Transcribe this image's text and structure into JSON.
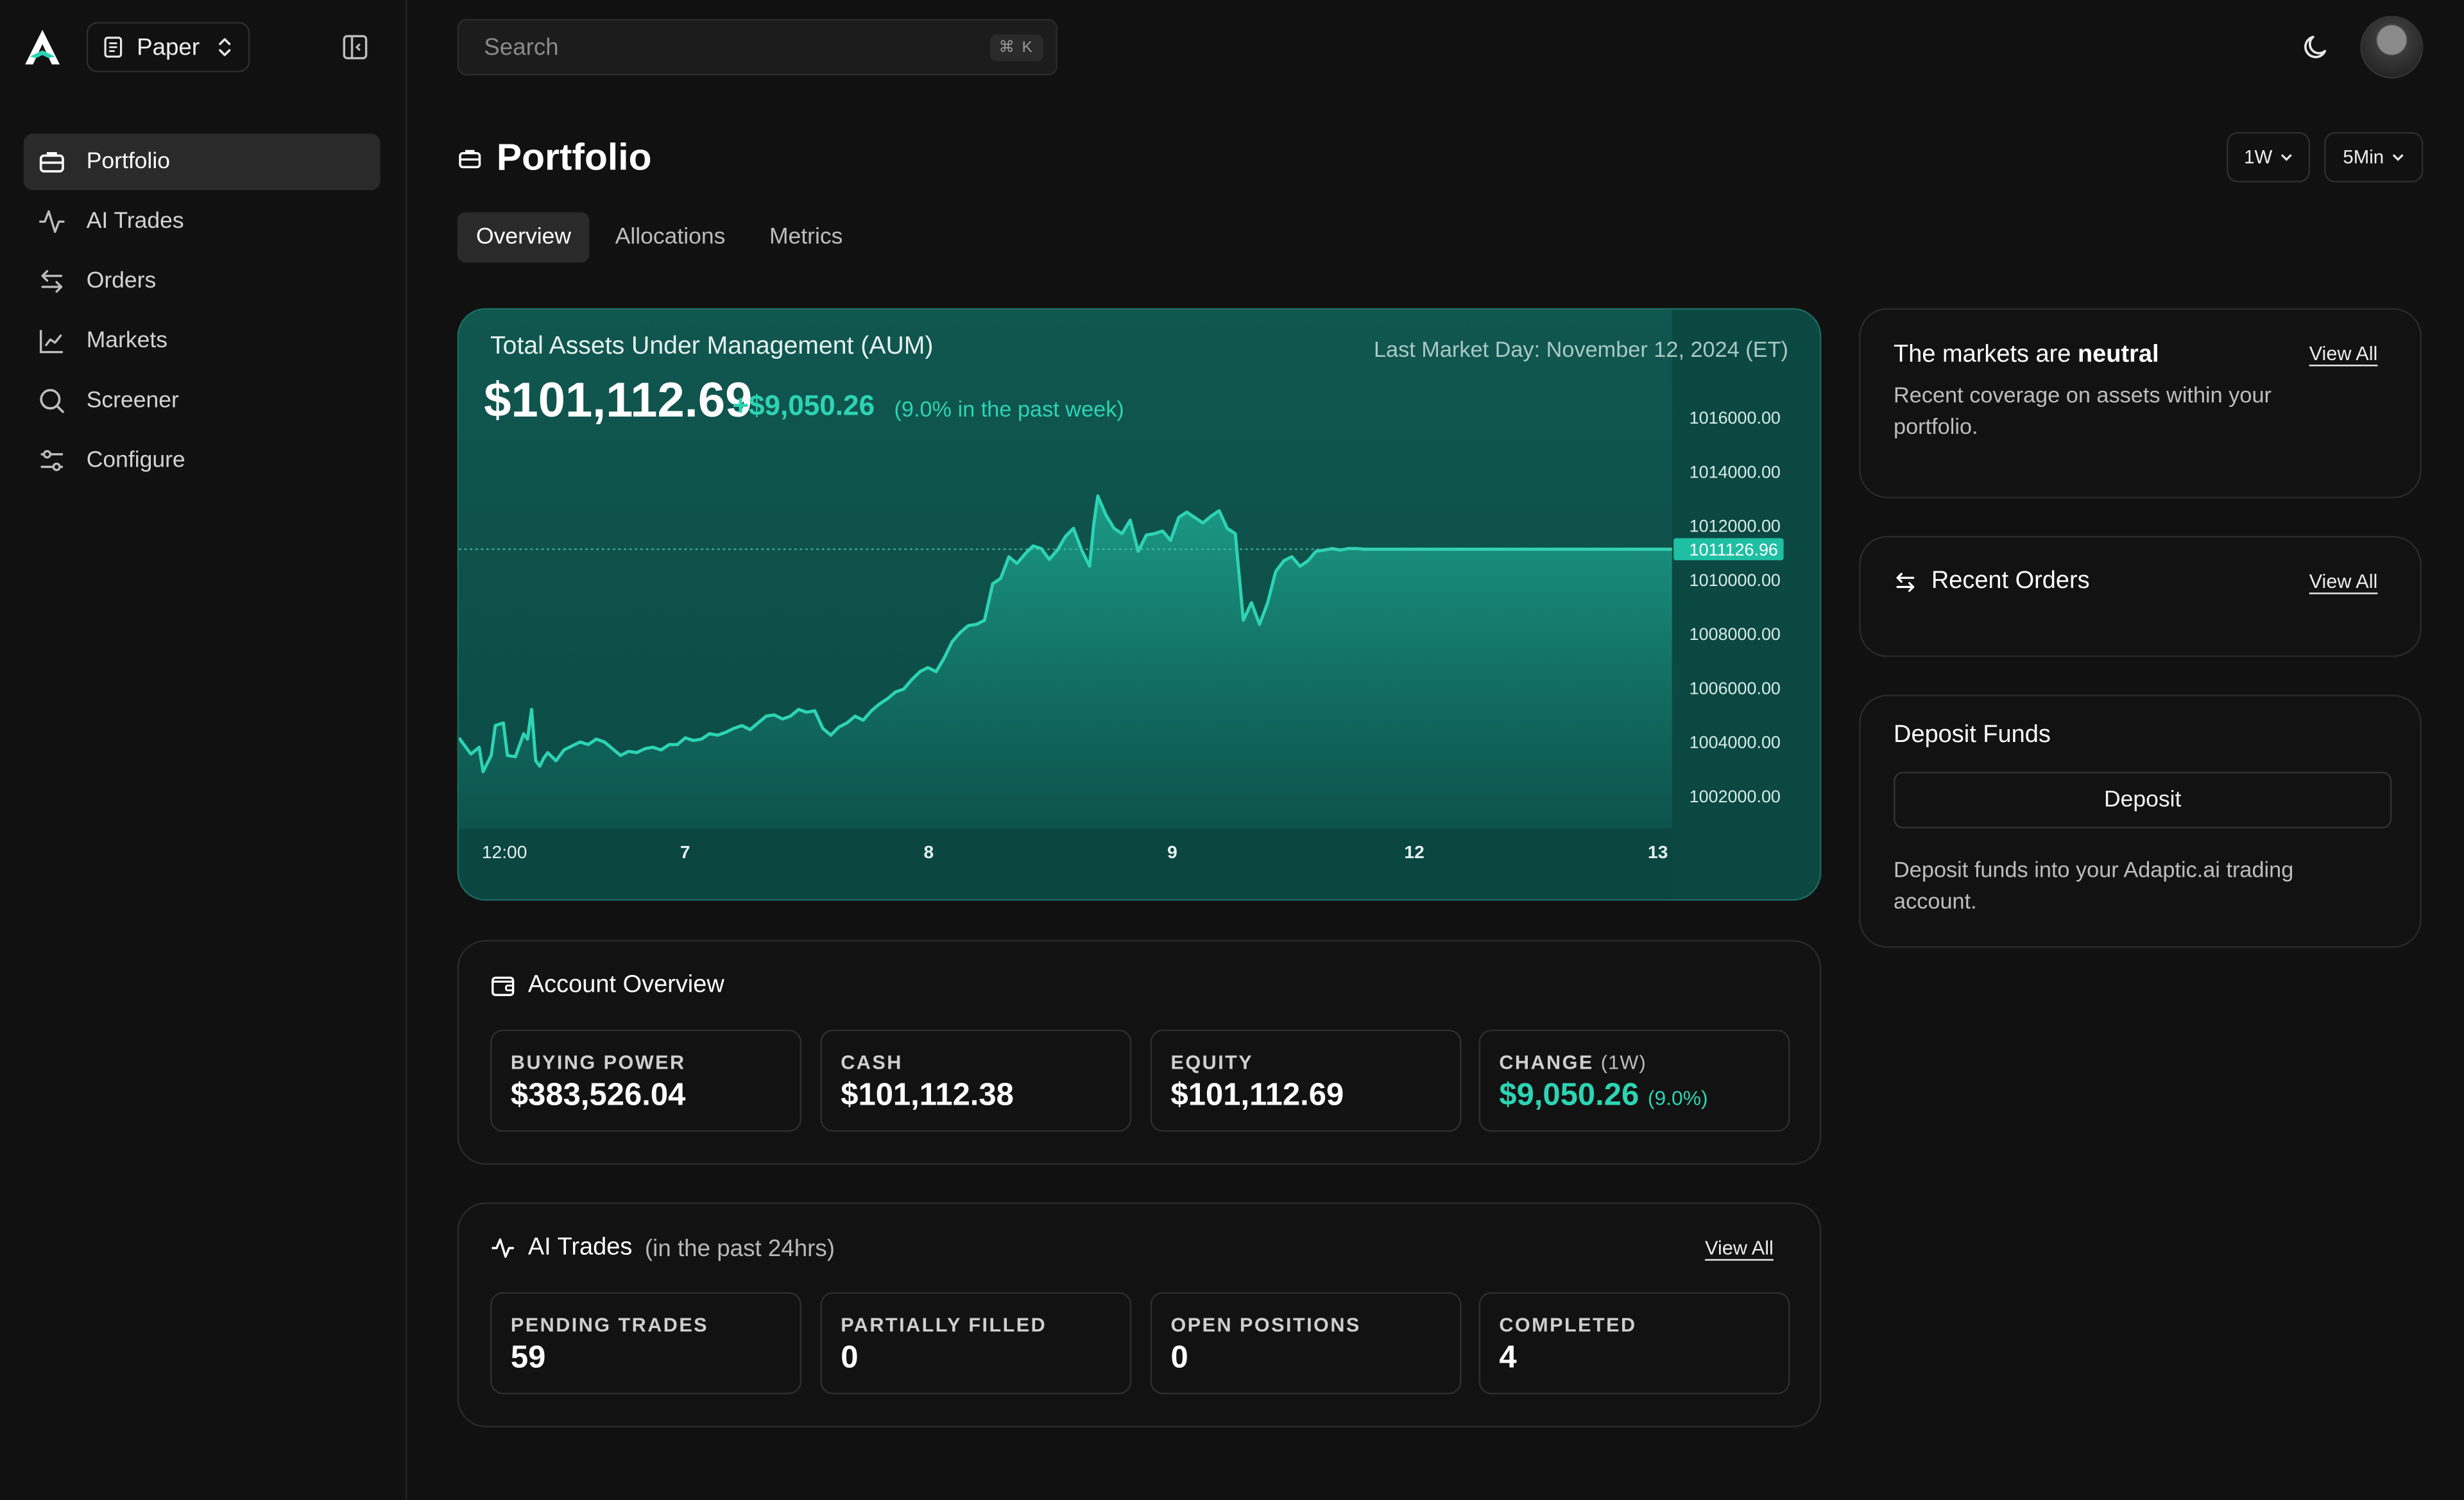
{
  "sidebar": {
    "workspace": "Paper",
    "items": [
      {
        "label": "Portfolio",
        "active": true,
        "icon": "briefcase-icon"
      },
      {
        "label": "AI Trades",
        "active": false,
        "icon": "activity-icon"
      },
      {
        "label": "Orders",
        "active": false,
        "icon": "arrows-left-right-icon"
      },
      {
        "label": "Markets",
        "active": false,
        "icon": "line-chart-icon"
      },
      {
        "label": "Screener",
        "active": false,
        "icon": "search-icon"
      },
      {
        "label": "Configure",
        "active": false,
        "icon": "sliders-icon"
      }
    ]
  },
  "topbar": {
    "search_placeholder": "Search",
    "shortcut": "⌘ K"
  },
  "page": {
    "title": "Portfolio",
    "range": "1W",
    "interval": "5Min",
    "tabs": [
      "Overview",
      "Allocations",
      "Metrics"
    ],
    "active_tab": "Overview"
  },
  "aum": {
    "title": "Total Assets Under Management (AUM)",
    "last_market_day": "Last Market Day: November 12, 2024 (ET)",
    "value": "$101,112.69",
    "change": "+$9,050.26",
    "change_pct": "(9.0% in the past week)",
    "current_marker": "1011126.96"
  },
  "chart_data": {
    "type": "area",
    "title": "",
    "xlabel": "",
    "ylabel": "",
    "x_ticks": [
      "12:00",
      "7",
      "8",
      "9",
      "12",
      "13"
    ],
    "y_ticks": [
      "1016000.00",
      "1014000.00",
      "1012000.00",
      "1010000.00",
      "1008000.00",
      "1006000.00",
      "1004000.00",
      "1002000.00"
    ],
    "ylim": [
      1000800,
      1016500
    ],
    "current_value": 1011126.96,
    "color": "#2dd4b4",
    "series": [
      {
        "x": [
          0,
          3,
          5,
          6,
          8,
          9,
          11,
          12,
          14,
          16,
          17,
          18,
          19,
          20,
          21,
          22,
          24,
          26,
          28,
          30,
          32,
          34,
          36,
          38,
          40,
          42,
          44,
          46,
          48,
          50,
          52,
          54,
          56,
          58,
          60,
          62,
          64,
          66,
          68,
          70,
          72,
          74,
          76,
          78,
          80,
          82,
          84,
          86,
          88,
          90,
          92,
          94,
          96,
          98,
          100,
          102,
          104,
          106,
          108,
          110,
          112,
          114,
          116,
          118,
          120,
          122,
          124,
          126,
          128,
          130,
          132,
          134,
          136,
          138,
          140,
          142,
          144,
          146,
          148,
          150,
          152,
          154,
          156,
          157,
          158,
          160,
          162,
          164,
          166,
          168,
          170,
          172,
          174,
          176,
          178,
          180,
          182,
          184,
          186,
          188,
          190,
          192,
          194,
          196,
          198,
          200,
          202,
          204,
          206,
          208,
          210,
          212,
          214,
          216,
          218,
          220,
          222,
          224,
          226,
          228,
          230,
          232,
          234,
          236,
          238,
          240,
          242,
          244,
          246,
          248,
          250,
          252,
          254,
          256,
          258,
          260,
          262,
          264,
          266,
          268,
          270,
          272,
          274,
          276,
          278,
          280,
          282,
          284,
          286,
          288,
          290,
          292,
          294,
          296,
          298,
          300
        ],
        "values": [
          1004150,
          1003550,
          1003800,
          1002900,
          1003500,
          1004600,
          1004700,
          1003500,
          1003450,
          1004300,
          1004100,
          1005200,
          1003300,
          1003100,
          1003400,
          1003600,
          1003300,
          1003700,
          1003850,
          1004000,
          1003900,
          1004100,
          1004000,
          1003750,
          1003500,
          1003650,
          1003600,
          1003750,
          1003800,
          1003700,
          1003900,
          1003900,
          1004150,
          1004050,
          1004100,
          1004300,
          1004250,
          1004350,
          1004500,
          1004600,
          1004450,
          1004700,
          1004950,
          1005000,
          1004850,
          1004950,
          1005200,
          1005100,
          1005150,
          1004500,
          1004250,
          1004550,
          1004700,
          1004950,
          1004800,
          1005150,
          1005400,
          1005600,
          1005850,
          1005950,
          1006300,
          1006600,
          1006750,
          1006600,
          1007100,
          1007700,
          1008050,
          1008300,
          1008350,
          1008500,
          1009850,
          1010050,
          1010850,
          1010600,
          1010950,
          1011250,
          1011150,
          1010750,
          1011100,
          1011600,
          1011900,
          1011100,
          1010500,
          1012050,
          1013100,
          1012400,
          1011900,
          1011700,
          1012200,
          1011050,
          1011650,
          1011700,
          1011800,
          1011450,
          1012300,
          1012500,
          1012300,
          1012100,
          1012350,
          1012550,
          1011900,
          1011700,
          1008500,
          1009150,
          1008350,
          1009150,
          1010300,
          1010700,
          1010850,
          1010500,
          1010700,
          1011050,
          1011100,
          1011150,
          1011100,
          1011150,
          1011150,
          1011130,
          1011130,
          1011127,
          1011127,
          1011127,
          1011127,
          1011127,
          1011127,
          1011127,
          1011127,
          1011127,
          1011127,
          1011127,
          1011127,
          1011127,
          1011127,
          1011127,
          1011127,
          1011127,
          1011127,
          1011127,
          1011127,
          1011127,
          1011127,
          1011127,
          1011127,
          1011127,
          1011127,
          1011127,
          1011127,
          1011127,
          1011127,
          1011127,
          1011127,
          1011127,
          1011127,
          1011127,
          1011127,
          1011127
        ]
      }
    ]
  },
  "account_overview": {
    "title": "Account Overview",
    "stats": [
      {
        "label": "BUYING POWER",
        "value": "$383,526.04"
      },
      {
        "label": "CASH",
        "value": "$101,112.38"
      },
      {
        "label": "EQUITY",
        "value": "$101,112.69"
      },
      {
        "label": "CHANGE",
        "label_suffix": "(1W)",
        "value": "$9,050.26",
        "value_suffix": "(9.0%)"
      }
    ]
  },
  "ai_trades": {
    "title": "AI Trades",
    "subtitle": "(in the past 24hrs)",
    "view_all": "View All",
    "stats": [
      {
        "label": "PENDING TRADES",
        "value": "59"
      },
      {
        "label": "PARTIALLY FILLED",
        "value": "0"
      },
      {
        "label": "OPEN POSITIONS",
        "value": "0"
      },
      {
        "label": "COMPLETED",
        "value": "4"
      }
    ]
  },
  "markets_card": {
    "title_prefix": "The markets are ",
    "title_emph": "neutral",
    "view_all": "View All",
    "text": "Recent coverage on assets within your portfolio."
  },
  "recent_orders": {
    "title": "Recent Orders",
    "view_all": "View All"
  },
  "deposit": {
    "title": "Deposit Funds",
    "button": "Deposit",
    "text": "Deposit funds into your Adaptic.ai trading account."
  }
}
